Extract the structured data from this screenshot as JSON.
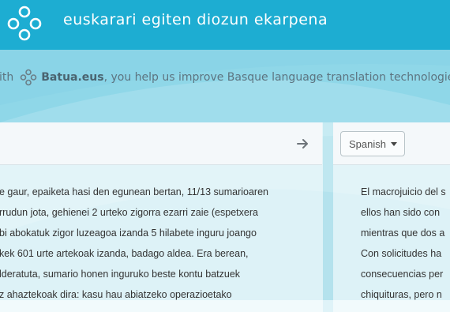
{
  "header": {
    "title": "euskarari egiten diozun ekarpena"
  },
  "tagline": {
    "prefix": "ith",
    "brand": "Batua.eus",
    "suffix": ", you help us improve Basque language translation technologies."
  },
  "icons": {
    "logo": "batua-logo-icon",
    "brand": "batua-logo-icon",
    "arrow": "arrow-right-icon",
    "caret": "caret-down-icon"
  },
  "colors": {
    "header": "#1dadd2",
    "band": "#8fd7e8",
    "background": "#dff3f8"
  },
  "language_select": {
    "value": "Spanish"
  },
  "source_text": [
    "e gaur, epaiketa hasi den egunean bertan, 11/13 sumarioaren",
    "rrudun jota, gehienei 2 urteko zigorra ezarri zaie (espetxera",
    "bi abokatuk zigor luzeagoa izanda 5 hilabete inguru joango",
    "kek 601 urte artekoak izanda, badago aldea. Era berean,",
    "lderatuta, sumario honen inguruko beste kontu batzuek",
    "z ahaztekoak dira: kasu hau abiatzeko operazioetako"
  ],
  "target_text": [
    "El macrojuicio del s",
    "ellos han sido con",
    "mientras que dos a",
    "Con solicitudes ha",
    "consecuencias per",
    "chiquituras, pero n"
  ]
}
